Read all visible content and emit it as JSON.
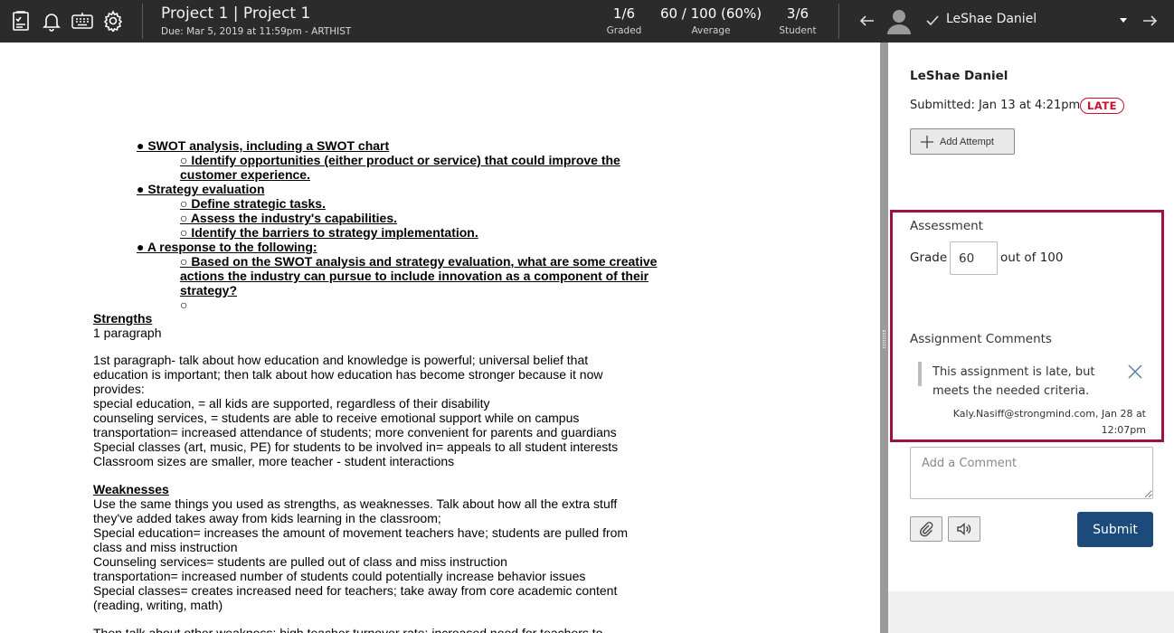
{
  "topbar": {
    "title": "Project 1 | Project 1",
    "due": "Due: Mar 5, 2019 at 11:59pm - ARTHIST",
    "stats": [
      {
        "value": "1/6",
        "label": "Graded"
      },
      {
        "value": "60 / 100 (60%)",
        "label": "Average"
      },
      {
        "value": "3/6",
        "label": "Student"
      }
    ],
    "student_name": "LeShae Daniel"
  },
  "document": {
    "lines": [
      "● SWOT analysis, including a SWOT chart",
      "○ Identify opportunities (either product or service) that could improve the",
      "customer experience.",
      "● Strategy evaluation",
      "○ Define strategic tasks.",
      "○ Assess the industry's capabilities.",
      "○ Identify the barriers to strategy implementation.",
      "● A response to the following:",
      "○ Based on the SWOT analysis and strategy evaluation, what are some creative",
      "actions the industry can pursue to include innovation as a component of their",
      "strategy?",
      "○",
      "Strengths",
      "1 paragraph",
      "1st paragraph- talk about how education and knowledge is powerful; universal belief that",
      "education is important; then talk about how education has become stronger because it now",
      "provides:",
      " special education, = all kids are supported, regardless of their disability",
      "counseling services, = students are able to receive emotional support while on campus",
      "transportation= increased attendance of students; more convenient for parents and guardians",
      "Special classes (art, music, PE) for students to be involved in= appeals to all student interests",
      "Classroom sizes are smaller, more teacher - student interactions",
      "Weaknesses",
      "Use the same things you used as strengths, as weaknesses. Talk about how all the extra stuff",
      "they've added takes away from kids learning in the classroom;",
      "Special education= increases the amount of movement teachers have; students are pulled from",
      "class and miss instruction",
      "Counseling services= students are pulled out of class and miss instruction",
      "transportation= increased number of students could potentially increase behavior issues",
      "Special classes= creates increased need for teachers; take away from core academic content",
      "(reading, writing, math)",
      "Then talk about other weakness: high teacher turnover rate; increased need for teachers to"
    ]
  },
  "panel": {
    "student_name": "LeShae Daniel",
    "submitted": "Submitted: Jan 13 at 4:21pm",
    "late_badge": "LATE",
    "add_attempt_label": "Add Attempt",
    "assessment_title": "Assessment",
    "grade_label": "Grade",
    "grade_value": "60",
    "out_of_label": "out of 100",
    "comments_title": "Assignment Comments",
    "comment_text": "This assignment is late, but meets the needed criteria.",
    "comment_meta": "Kaly.Nasiff@strongmind.com, Jan 28 at 12:07pm",
    "add_comment_placeholder": "Add a Comment",
    "submit_label": "Submit"
  },
  "colors": {
    "topbar_bg": "#2b2b2b",
    "highlight_border": "#a0123a",
    "late_red": "#c8102e",
    "submit_blue": "#1c4a7a"
  },
  "icons": [
    "grade-list-icon",
    "bell-icon",
    "keyboard-icon",
    "gear-icon",
    "arrow-left-icon",
    "avatar-icon",
    "check-icon",
    "caret-down-icon",
    "arrow-right-icon",
    "plus-icon",
    "close-icon",
    "paperclip-icon",
    "speaker-icon"
  ]
}
